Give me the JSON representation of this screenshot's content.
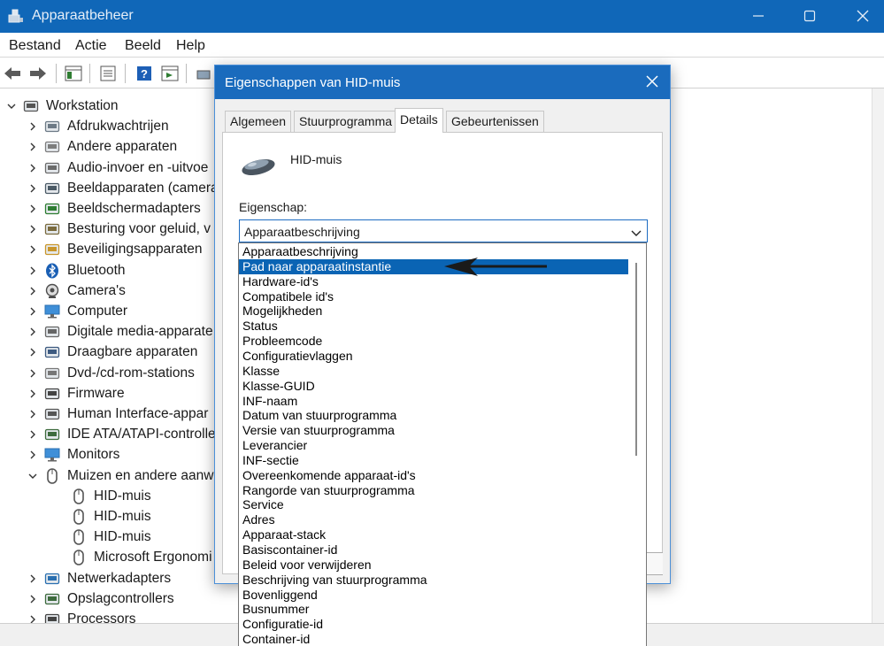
{
  "window": {
    "title": "Apparaatbeheer"
  },
  "menubar": {
    "items": [
      "Bestand",
      "Actie",
      "Beeld",
      "Help"
    ]
  },
  "tree": {
    "root": "Workstation",
    "items": [
      {
        "label": "Afdrukwachtrijen",
        "icon": "printer-icon",
        "expanded": false
      },
      {
        "label": "Andere apparaten",
        "icon": "unknown-device-icon",
        "expanded": false
      },
      {
        "label": "Audio-invoer en -uitvoe",
        "icon": "speaker-icon",
        "expanded": false
      },
      {
        "label": "Beeldapparaten (camera",
        "icon": "scanner-icon",
        "expanded": false
      },
      {
        "label": "Beeldschermadapters",
        "icon": "display-adapter-icon",
        "expanded": false
      },
      {
        "label": "Besturing voor geluid, v",
        "icon": "sound-controller-icon",
        "expanded": false
      },
      {
        "label": "Beveiligingsapparaten",
        "icon": "security-key-icon",
        "expanded": false
      },
      {
        "label": "Bluetooth",
        "icon": "bluetooth-icon",
        "expanded": false
      },
      {
        "label": "Camera's",
        "icon": "camera-icon",
        "expanded": false
      },
      {
        "label": "Computer",
        "icon": "monitor-icon",
        "expanded": false
      },
      {
        "label": "Digitale media-apparate",
        "icon": "media-device-icon",
        "expanded": false
      },
      {
        "label": "Draagbare apparaten",
        "icon": "portable-device-icon",
        "expanded": false
      },
      {
        "label": "Dvd-/cd-rom-stations",
        "icon": "disc-drive-icon",
        "expanded": false
      },
      {
        "label": "Firmware",
        "icon": "firmware-icon",
        "expanded": false
      },
      {
        "label": "Human Interface-appar",
        "icon": "hid-icon",
        "expanded": false
      },
      {
        "label": "IDE ATA/ATAPI-controlle",
        "icon": "ide-controller-icon",
        "expanded": false
      },
      {
        "label": "Monitors",
        "icon": "monitor-icon",
        "expanded": false
      },
      {
        "label": "Muizen en andere aanw",
        "icon": "mouse-icon",
        "expanded": true
      }
    ],
    "children": [
      "HID-muis",
      "HID-muis",
      "HID-muis",
      "Microsoft Ergonomi"
    ],
    "after": [
      {
        "label": "Netwerkadapters",
        "icon": "network-adapter-icon"
      },
      {
        "label": "Opslagcontrollers",
        "icon": "storage-controller-icon"
      },
      {
        "label": "Processors",
        "icon": "processor-icon"
      }
    ]
  },
  "dialog": {
    "title": "Eigenschappen van HID-muis",
    "tabs": [
      "Algemeen",
      "Stuurprogramma",
      "Details",
      "Gebeurtenissen"
    ],
    "active_tab": "Details",
    "device_name": "HID-muis",
    "property_label": "Eigenschap:",
    "property_value": "Apparaatbeschrijving"
  },
  "dropdown": {
    "selected": "Pad naar apparaatinstantie",
    "options": [
      "Apparaatbeschrijving",
      "Pad naar apparaatinstantie",
      "Hardware-id's",
      "Compatibele id's",
      "Mogelijkheden",
      "Status",
      "Probleemcode",
      "Configuratievlaggen",
      "Klasse",
      "Klasse-GUID",
      "INF-naam",
      "Datum van stuurprogramma",
      "Versie van stuurprogramma",
      "Leverancier",
      "INF-sectie",
      "Overeenkomende apparaat-id's",
      "Rangorde van stuurprogramma",
      "Service",
      "Adres",
      "Apparaat-stack",
      "Basiscontainer-id",
      "Beleid voor verwijderen",
      "Beschrijving van stuurprogramma",
      "Bovenliggend",
      "Busnummer",
      "Configuratie-id",
      "Container-id"
    ]
  },
  "colors": {
    "titlebar": "#1067b8",
    "dialog_titlebar": "#1a6bbd",
    "selection": "#0a64b4"
  }
}
